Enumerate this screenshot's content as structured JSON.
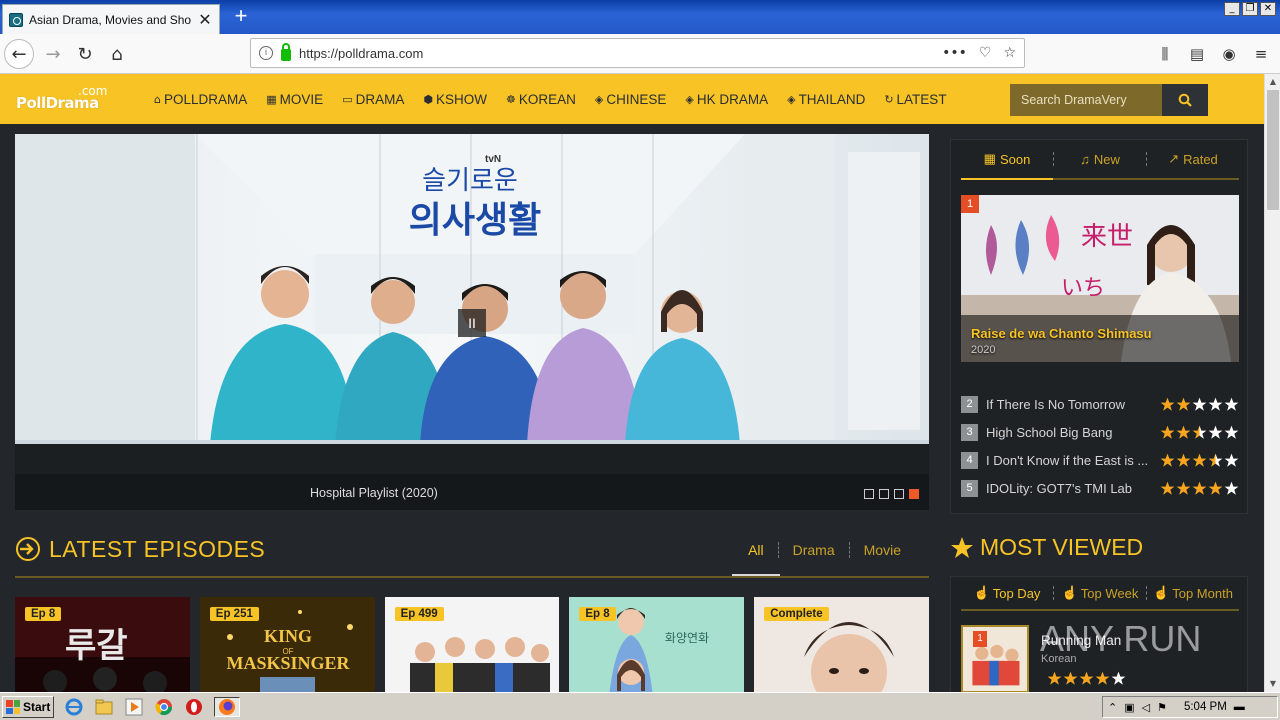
{
  "browser": {
    "tab_title": "Asian Drama, Movies and Shows E",
    "url": "https://polldrama.com"
  },
  "site": {
    "logo_main": "PollDrama",
    "logo_sub": ".com",
    "nav": [
      {
        "label": "POLLDRAMA",
        "icon": "home-icon"
      },
      {
        "label": "MOVIE",
        "icon": "film-icon"
      },
      {
        "label": "DRAMA",
        "icon": "tv-icon"
      },
      {
        "label": "KSHOW",
        "icon": "hexagon-icon"
      },
      {
        "label": "KOREAN",
        "icon": "mask-icon"
      },
      {
        "label": "CHINESE",
        "icon": "tag-icon"
      },
      {
        "label": "HK DRAMA",
        "icon": "tag-icon"
      },
      {
        "label": "THAILAND",
        "icon": "tag-icon"
      },
      {
        "label": "LATEST",
        "icon": "refresh-icon"
      }
    ],
    "search_placeholder": "Search DramaVery"
  },
  "slider": {
    "caption": "Hospital Playlist (2020)",
    "poster_text": "슬기로운 의사생활",
    "poster_network": "tvN",
    "dots": 4,
    "active_dot": 4
  },
  "widget": {
    "tabs": [
      {
        "label": "Soon",
        "icon": "calendar-icon",
        "active": true
      },
      {
        "label": "New",
        "icon": "bell-icon",
        "active": false
      },
      {
        "label": "Rated",
        "icon": "chart-icon",
        "active": false
      }
    ],
    "featured": {
      "rank": "1",
      "title": "Raise de wa Chanto Shimasu",
      "year": "2020"
    },
    "list": [
      {
        "rank": "2",
        "title": "If There Is No Tomorrow",
        "rating": 2
      },
      {
        "rank": "3",
        "title": "High School Big Bang",
        "rating": 2.5
      },
      {
        "rank": "4",
        "title": "I Don't Know if the East is ...",
        "rating": 3.5
      },
      {
        "rank": "5",
        "title": "IDOLity: GOT7's TMI Lab",
        "rating": 4
      }
    ]
  },
  "latest": {
    "title": "LATEST EPISODES",
    "filters": [
      "All",
      "Drama",
      "Movie"
    ],
    "cards": [
      {
        "badge": "Ep 8",
        "art_text": "루갈"
      },
      {
        "badge": "Ep 251",
        "art_text": "KING OF MASKSINGER"
      },
      {
        "badge": "Ep 499",
        "art_text": ""
      },
      {
        "badge": "Ep 8",
        "art_text": ""
      },
      {
        "badge": "Complete",
        "art_text": ""
      }
    ]
  },
  "most_viewed": {
    "title": "MOST VIEWED",
    "tabs": [
      "Top Day",
      "Top Week",
      "Top Month"
    ],
    "item": {
      "rank": "1",
      "name": "Running Man",
      "country": "Korean",
      "rating": 4
    }
  },
  "watermark": "ANY RUN",
  "taskbar": {
    "start_label": "Start",
    "clock": "5:04 PM"
  },
  "colors": {
    "brand_yellow": "#f7c325",
    "background": "#23272b",
    "accent_red": "#e54d24"
  }
}
